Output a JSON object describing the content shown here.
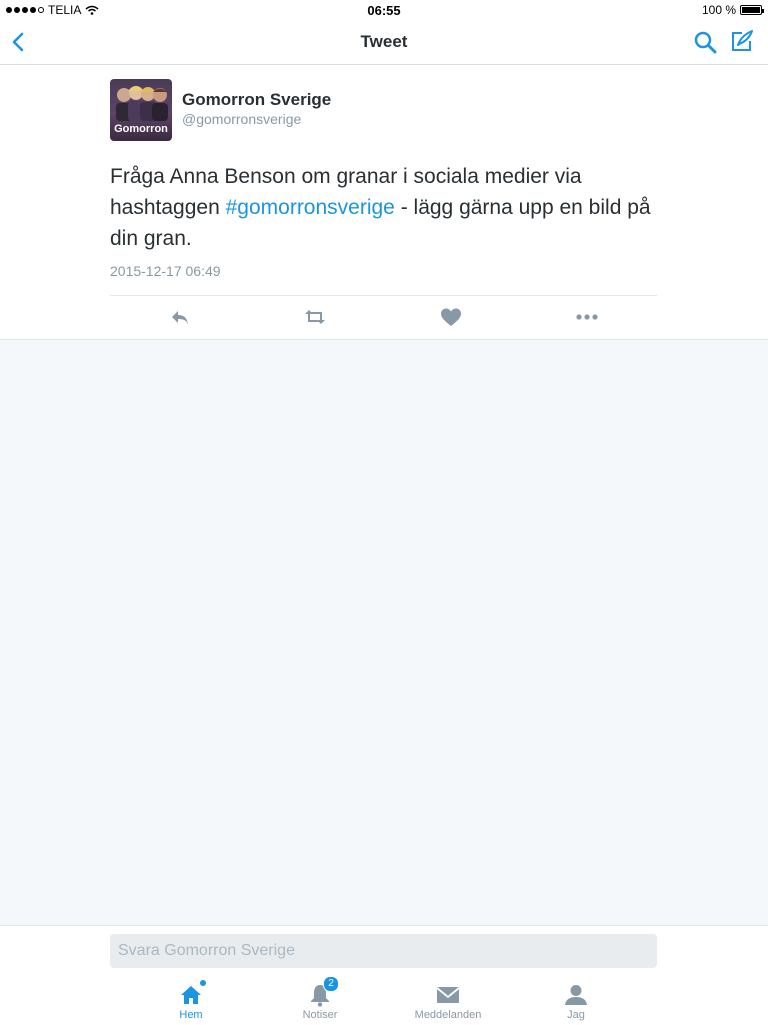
{
  "status_bar": {
    "carrier": "TELIA",
    "time": "06:55",
    "battery": "100 %"
  },
  "nav": {
    "title": "Tweet",
    "back_icon": "chevron-left-icon",
    "search_icon": "search-icon",
    "compose_icon": "compose-icon"
  },
  "tweet": {
    "avatar_label": "Gomorron",
    "display_name": "Gomorron Sverige",
    "handle": "@gomorronsverige",
    "text_before": "Fråga Anna Benson om granar i sociala medier via hashtaggen ",
    "hashtag": "#gomorronsverige",
    "text_after": " - lägg gärna upp en bild på din gran.",
    "timestamp": "2015-12-17 06:49",
    "actions": [
      "reply-icon",
      "retweet-icon",
      "like-icon",
      "more-icon"
    ]
  },
  "reply": {
    "placeholder": "Svara Gomorron Sverige"
  },
  "tabs": [
    {
      "label": "Hem",
      "icon": "home-icon",
      "active": true
    },
    {
      "label": "Notiser",
      "icon": "bell-icon",
      "badge": "2"
    },
    {
      "label": "Meddelanden",
      "icon": "envelope-icon"
    },
    {
      "label": "Jag",
      "icon": "person-icon"
    }
  ],
  "colors": {
    "accent": "#1b95e0",
    "icon_gray": "#8899a6",
    "text": "#292f33",
    "background": "#f5f8fa"
  }
}
